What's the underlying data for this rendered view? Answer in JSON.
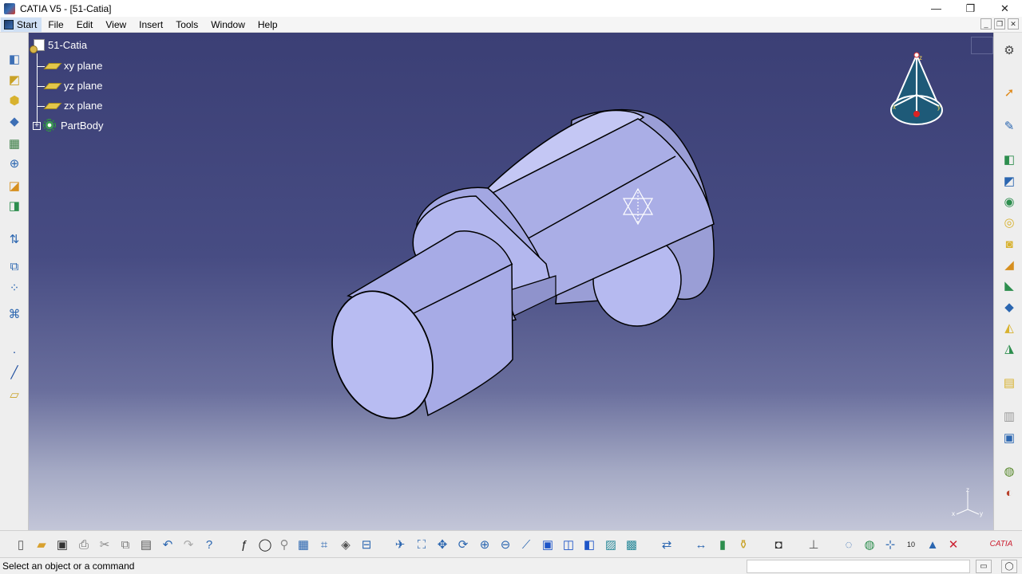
{
  "window": {
    "title": "CATIA V5 - [51-Catia]",
    "minimize_glyph": "—",
    "maximize_glyph": "❐",
    "close_glyph": "✕"
  },
  "menu": {
    "start": "Start",
    "items": [
      "File",
      "Edit",
      "View",
      "Insert",
      "Tools",
      "Window",
      "Help"
    ]
  },
  "tree": {
    "root": "51-Catia",
    "planes": [
      "xy plane",
      "yz plane",
      "zx plane"
    ],
    "body": "PartBody"
  },
  "compass": {
    "axes": [
      "x",
      "y",
      "z"
    ]
  },
  "viewport": {
    "background_top": "#3b3f75",
    "background_bottom": "#c3c6d8",
    "part_fill": "#b5b9e8",
    "part_fill_dark": "#9498cf"
  },
  "status": {
    "message": "Select an object or a command"
  },
  "toolbars": {
    "left": [
      "pad-icon",
      "pocket-icon",
      "shaft-icon",
      "groove-icon",
      "hole-icon",
      "rib-icon",
      "fillet-icon",
      "draft-icon",
      "measure-icon",
      "mirror-icon",
      "pattern-icon",
      "transform-icon",
      "point-icon",
      "line-icon",
      "plane-icon"
    ],
    "right": [
      "settings-icon",
      "select-arrow-icon",
      "sketch-icon",
      "pad-icon",
      "pocket-icon",
      "shaft-icon",
      "groove-icon",
      "hole-icon",
      "rib-icon",
      "slot-icon",
      "stiffener-icon",
      "loft-icon",
      "remove-loft-icon",
      "thickness-icon",
      "shell-icon",
      "boolean-icon",
      "catalog-icon",
      "apply-material-icon"
    ],
    "bottom": [
      "new-icon",
      "open-icon",
      "save-icon",
      "print-icon",
      "cut-icon",
      "copy-icon",
      "paste-icon",
      "undo-icon",
      "redo-icon",
      "whats-this-icon",
      "formula-icon",
      "comment-icon",
      "sensor-icon",
      "table-icon",
      "knowledge-icon",
      "scan-icon",
      "graph-icon",
      "fly-mode-icon",
      "fit-all-icon",
      "pan-icon",
      "rotate-icon",
      "zoom-in-icon",
      "zoom-out-icon",
      "normal-view-icon",
      "iso-view-icon",
      "front-view-icon",
      "render-icon",
      "shading-icon",
      "hide-show-icon",
      "swap-icon",
      "measure-between-icon",
      "measure-item-icon",
      "mass-icon",
      "capture-icon",
      "axis-system-icon",
      "sketch-analysis-icon",
      "update-icon",
      "cycle-icon",
      "dimension-icon",
      "round-icon",
      "repair-icon",
      "catia-logo"
    ]
  }
}
